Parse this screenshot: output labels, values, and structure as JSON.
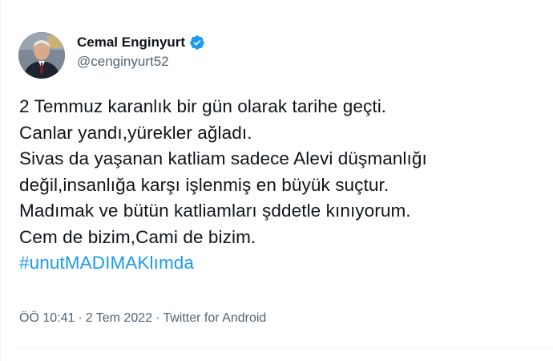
{
  "author": {
    "display_name": "Cemal Enginyurt",
    "handle": "@cenginyurt52",
    "verified": true,
    "verified_color": "#1d9bf0"
  },
  "tweet": {
    "lines": [
      "2 Temmuz karanlık bir gün olarak tarihe geçti.",
      "Canlar yandı,yürekler ağladı.",
      "Sivas da yaşanan katliam sadece Alevi düşmanlığı",
      "değil,insanlığa karşı işlenmiş en büyük suçtur.",
      "Madımak ve bütün katliamları şddetle kınıyorum.",
      "Cem de bizim,Cami de bizim."
    ],
    "hashtag": "#unutMADIMAKlımda",
    "hashtag_color": "#1d9bf0"
  },
  "meta": {
    "time": "ÖÖ 10:41",
    "separator_1": "·",
    "date": "2 Tem 2022",
    "separator_2": "·",
    "source": "Twitter for Android"
  },
  "colors": {
    "text": "#0f1419",
    "secondary": "#536471",
    "border": "#eff3f4"
  }
}
